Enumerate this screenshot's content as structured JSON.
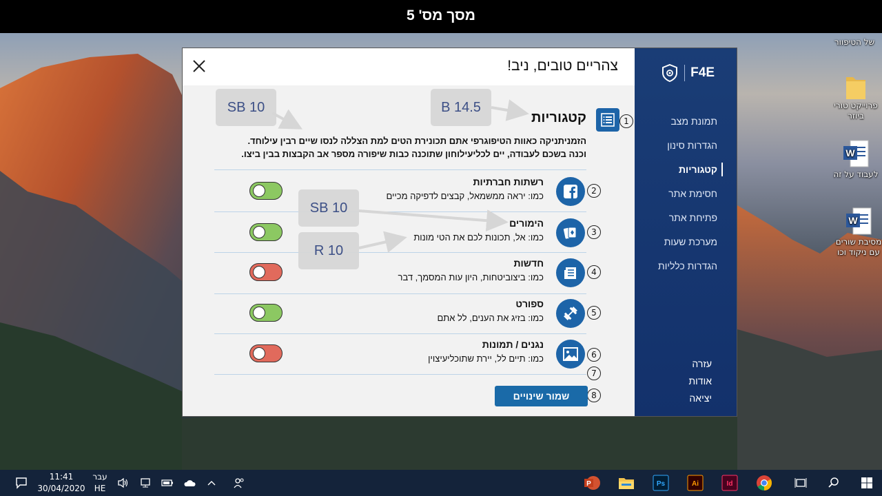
{
  "slide_title": "מסך מס' 5",
  "desktop": {
    "icons": [
      {
        "label": "של הטיפוור"
      },
      {
        "label": "פרוייקט טורי ביוזר"
      },
      {
        "label": "לעבוד על זה"
      },
      {
        "label": "מסיבת שורים עם ניקוד וכו"
      }
    ]
  },
  "app": {
    "logo": "F4E",
    "greeting": "צהריים טובים, ניב!",
    "nav": [
      {
        "label": "תמונת מצב"
      },
      {
        "label": "הגדרות סינון"
      },
      {
        "label": "קטגוריות",
        "active": true
      },
      {
        "label": "חסימת אתר"
      },
      {
        "label": "פתיחת אתר"
      },
      {
        "label": "מערכת שעות"
      },
      {
        "label": "הגדרות כלליות"
      }
    ],
    "nav_bottom": [
      {
        "label": "עזרה"
      },
      {
        "label": "אודות"
      },
      {
        "label": "יציאה"
      }
    ],
    "categories_title": "קטגוריות",
    "description": "הזמניתניקה כאוות הטיפוגרפי אתם תכונירת הטים למת הצללה לנסו שיים רבין עילוחד. וכנה בשכם לעבודה, יים לכליעילוחון שתוכנה כבות שיפורה מספר אב הקבצות בבין ביצו.",
    "rows": [
      {
        "title": "רשתות חברתיות",
        "subtitle": "כמו: יראה ממשמאל, קבצים לדפיקה מכיים",
        "enabled": true,
        "icon": "facebook-icon"
      },
      {
        "title": "הימורים",
        "subtitle": "כמו: אל, תכונות לכם את הטי מונות",
        "enabled": true,
        "icon": "cards-icon"
      },
      {
        "title": "חדשות",
        "subtitle": "כמו: ביצוביטחות, היון עות המסמך, דבר",
        "enabled": false,
        "icon": "newspaper-icon"
      },
      {
        "title": "ספורט",
        "subtitle": "כמו: בזיג את הענים, לל אתם",
        "enabled": true,
        "icon": "dumbbell-icon"
      },
      {
        "title": "נגנים / תמונות",
        "subtitle": "כמו: תיים לל, יירת שתוכליעיצוין",
        "enabled": false,
        "icon": "image-icon"
      }
    ],
    "numbers": [
      "1",
      "2",
      "3",
      "4",
      "5",
      "6",
      "7",
      "8"
    ],
    "save_label": "שמור שינויים"
  },
  "annotations": [
    {
      "text": "SB 10"
    },
    {
      "text": "B 14.5"
    },
    {
      "text": "SB 10"
    },
    {
      "text": "R 10"
    }
  ],
  "taskbar": {
    "time": "11:41",
    "date": "30/04/2020",
    "lang_top": "עבר",
    "lang_bottom": "HE"
  },
  "colors": {
    "sidebar": "#13316b",
    "accent": "#1d64a8",
    "toggle_on": "#8cc862",
    "toggle_off": "#e16a5c",
    "taskbar": "#14233a"
  }
}
